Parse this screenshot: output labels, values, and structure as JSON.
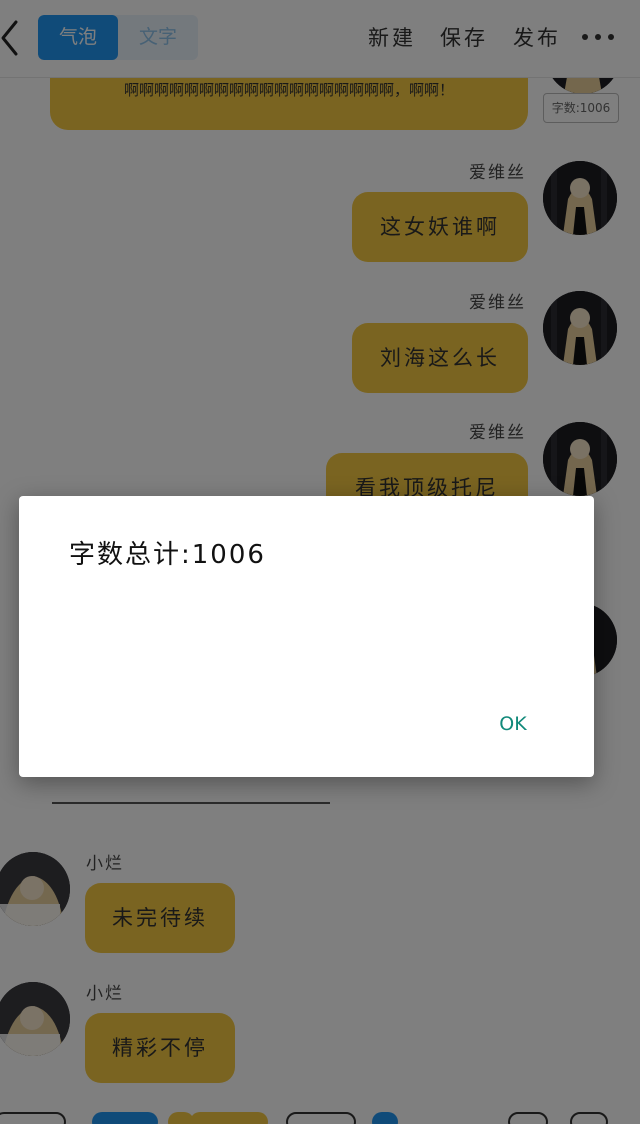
{
  "toolbar": {
    "mode_bubble": "气泡",
    "mode_text": "文字",
    "new_label": "新建",
    "save_label": "保存",
    "publish_label": "发布"
  },
  "chat": {
    "top_message": "啊啊啊啊啊啊啊啊啊啊啊啊啊啊啊啊啊啊，啊啊！",
    "word_count_chip": "字数:1006",
    "messages": [
      {
        "sender": "爱维丝",
        "text": "这女妖谁啊",
        "side": "right"
      },
      {
        "sender": "爱维丝",
        "text": "刘海这么长",
        "side": "right"
      },
      {
        "sender": "爱维丝",
        "text": "看我顶级托尼",
        "side": "right"
      },
      {
        "sender": "小烂",
        "text": "未完待续",
        "side": "left"
      },
      {
        "sender": "小烂",
        "text": "精彩不停",
        "side": "left"
      }
    ]
  },
  "dialog": {
    "message": "字数总计:1006",
    "ok_label": "OK"
  },
  "colors": {
    "accent": "#2196f3",
    "bubble": "#f5c842",
    "ok": "#11897a"
  }
}
